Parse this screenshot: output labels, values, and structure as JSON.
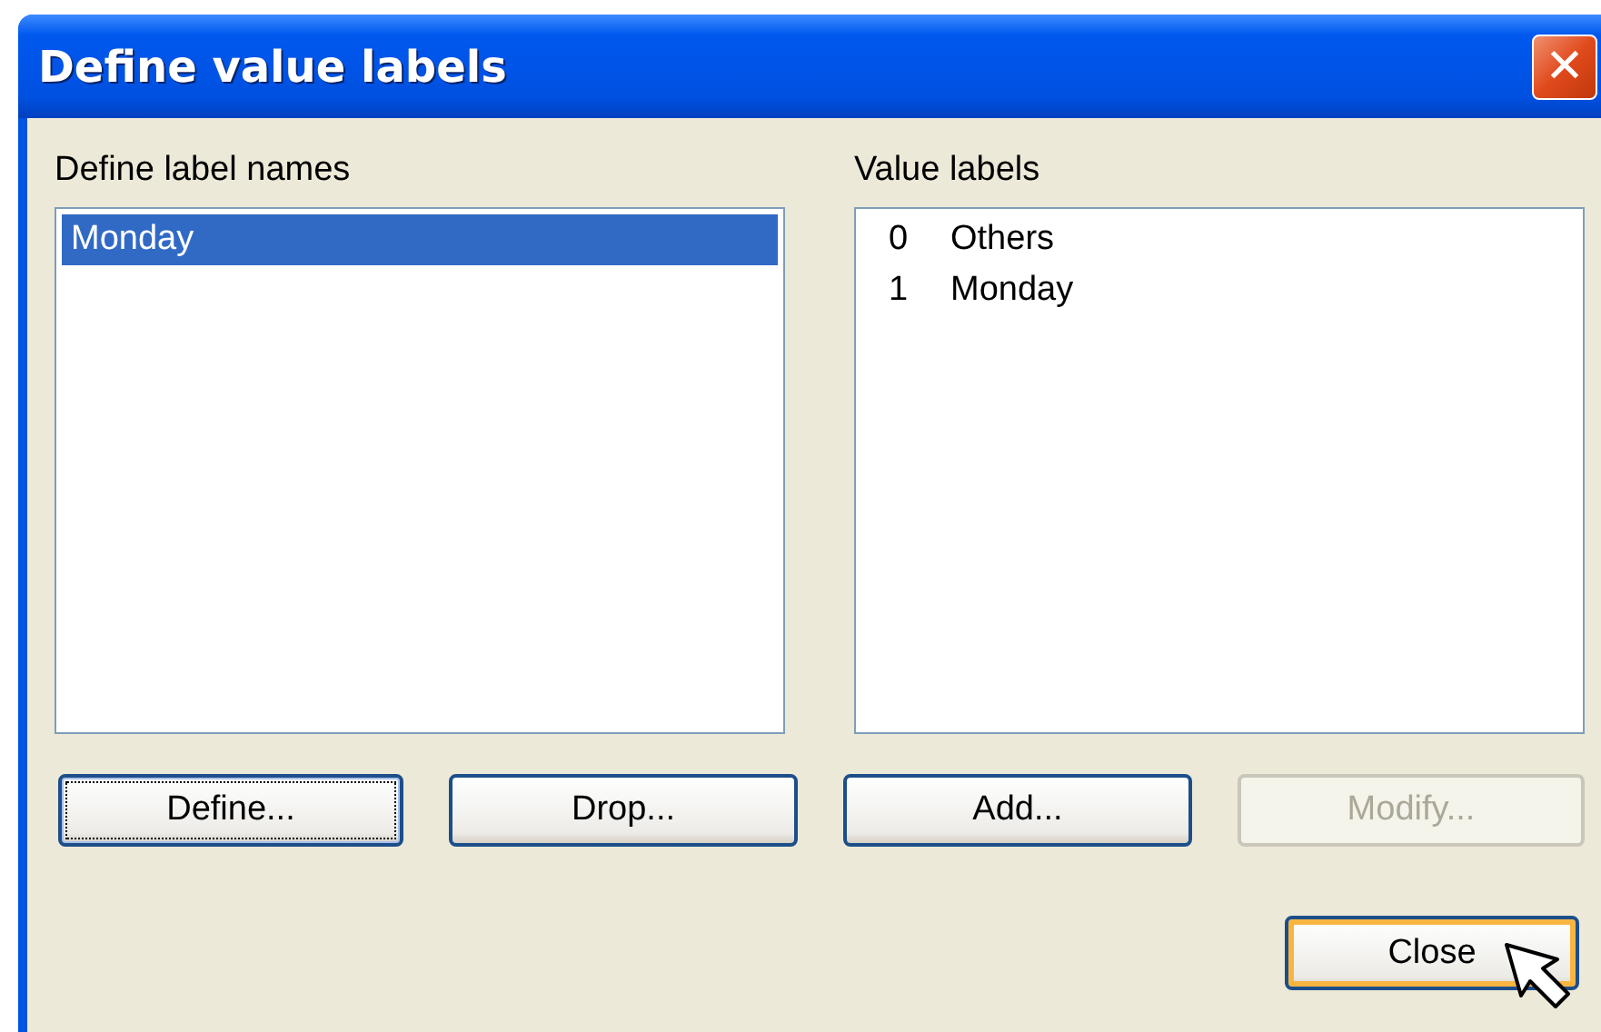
{
  "window": {
    "title": "Define value labels",
    "close_glyph": "✕"
  },
  "label_names": {
    "heading": "Define label names",
    "items": [
      {
        "label": "Monday",
        "selected": true
      }
    ]
  },
  "value_labels": {
    "heading": "Value labels",
    "items": [
      {
        "value": "0",
        "label": "Others"
      },
      {
        "value": "1",
        "label": "Monday"
      }
    ]
  },
  "buttons": [
    {
      "label": "Define...",
      "disabled": false,
      "focused": true,
      "hovered": false
    },
    {
      "label": "Drop...",
      "disabled": false,
      "focused": false,
      "hovered": false
    },
    {
      "label": "Add...",
      "disabled": false,
      "focused": false,
      "hovered": false
    },
    {
      "label": "Modify...",
      "disabled": true,
      "focused": false,
      "hovered": false
    }
  ],
  "close_button": {
    "label": "Close",
    "disabled": false,
    "focused": false,
    "hovered": true
  }
}
